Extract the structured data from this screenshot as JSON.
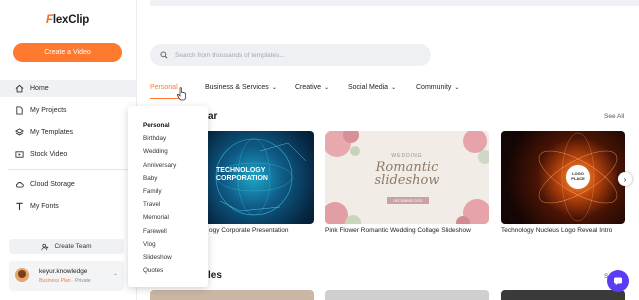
{
  "brand": {
    "logo_mark": "F",
    "logo_text": "lexClip"
  },
  "sidebar": {
    "create_label": "Create a Video",
    "items": [
      {
        "label": "Home",
        "icon": "home-icon"
      },
      {
        "label": "My Projects",
        "icon": "file-icon"
      },
      {
        "label": "My Templates",
        "icon": "layers-icon"
      },
      {
        "label": "Stock Video",
        "icon": "video-icon"
      },
      {
        "label": "Cloud Storage",
        "icon": "cloud-icon"
      },
      {
        "label": "My Fonts",
        "icon": "font-icon"
      }
    ],
    "team_label": "Create Team",
    "user": {
      "name": "keyur.knowledge",
      "plan": "Business Plan",
      "privacy": "· Private"
    }
  },
  "search": {
    "placeholder": "Search from thousands of templates..."
  },
  "categories": [
    {
      "label": "Personal",
      "chevron": "⌄"
    },
    {
      "label": "Business & Services",
      "chevron": "⌄"
    },
    {
      "label": "Creative",
      "chevron": "⌄"
    },
    {
      "label": "Social Media",
      "chevron": "⌄"
    },
    {
      "label": "Community",
      "chevron": "⌄"
    }
  ],
  "dropdown": {
    "items": [
      "Personal",
      "Birthday",
      "Wedding",
      "Anniversary",
      "Baby",
      "Family",
      "Travel",
      "Memorial",
      "Farewell",
      "Vlog",
      "Slideshow",
      "Quotes"
    ]
  },
  "sections": {
    "popular": {
      "title_visible": "ar",
      "see_all": "See All"
    },
    "second": {
      "title_visible": "les",
      "see_all": "S"
    }
  },
  "templates": [
    {
      "caption": "ogy Corporate Presentation",
      "overlay_line1": "TECHNOLOGY",
      "overlay_line2": "CORPORATION"
    },
    {
      "caption": "Pink Flower Romantic Wedding Collage Slideshow",
      "overlay_top": "WEDDING",
      "overlay_script1": "Romantic",
      "overlay_script2": "slideshow",
      "overlay_date": "DECEMBER 2022"
    },
    {
      "caption": "Technology Nucleus Logo Reveal Intro",
      "overlay_logo1": "LOGO",
      "overlay_logo2": "PLACE"
    }
  ],
  "colors": {
    "accent": "#ff7a2f",
    "chat": "#5b3cf5",
    "sidebar_active": "#f0f1f4"
  }
}
